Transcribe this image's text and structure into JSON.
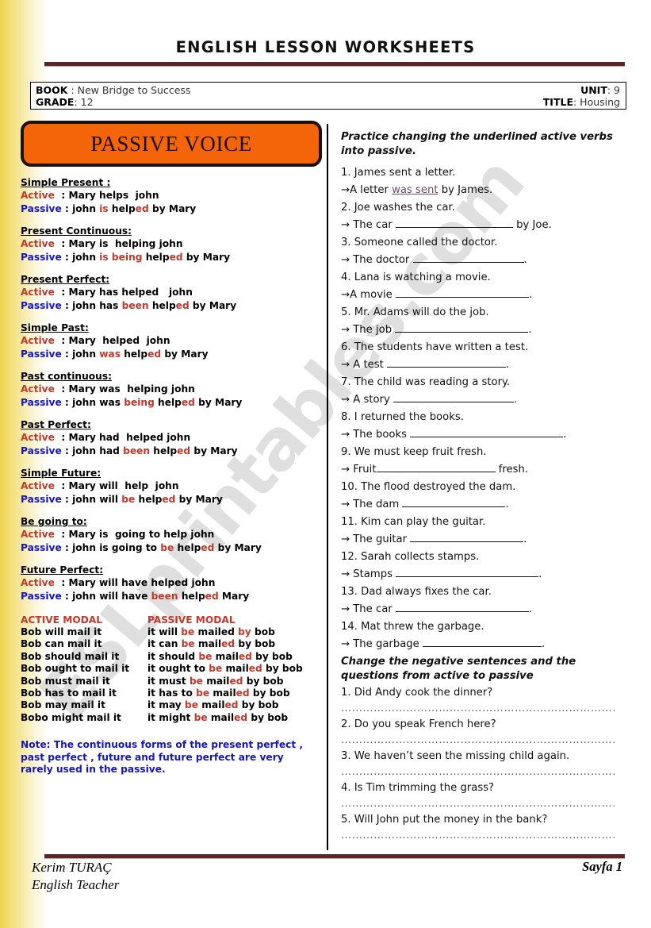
{
  "header": {
    "doc_title": "ENGLISH LESSON WORKSHEETS",
    "book_label": "BOOK",
    "book_value": ": New Bridge to Success",
    "grade_label": "GRADE",
    "grade_value": ": 12",
    "unit_label": "UNIT",
    "unit_value": ": 9",
    "title_label": "TITLE",
    "title_value": ": Housing"
  },
  "left": {
    "title_box": "PASSIVE VOICE",
    "active_label": "Active",
    "passive_label": "Passive",
    "tenses": [
      {
        "head": "Simple Present :",
        "active_sep": "  : ",
        "active": "Mary helps  john",
        "passive_sep": " : ",
        "passive_pre": "john ",
        "passive_aux": "is",
        "passive_mid": " help",
        "passive_ed": "ed",
        "passive_post": " by Mary"
      },
      {
        "head": "Present Continuous:",
        "active_sep": "  : ",
        "active": "Mary is  helping john",
        "passive_sep": " : ",
        "passive_pre": "john ",
        "passive_aux": "is being",
        "passive_mid": " help",
        "passive_ed": "ed",
        "passive_post": " by Mary"
      },
      {
        "head": "Present Perfect:",
        "active_sep": "  : ",
        "active": "Mary has helped   john",
        "passive_sep": " : ",
        "passive_pre": "john has ",
        "passive_aux": "been",
        "passive_mid": " help",
        "passive_ed": "ed",
        "passive_post": " by Mary"
      },
      {
        "head": "Simple Past:",
        "active_sep": "  : ",
        "active": "Mary  helped  john",
        "passive_sep": " : ",
        "passive_pre": "john ",
        "passive_aux": "was",
        "passive_mid": " help",
        "passive_ed": "ed",
        "passive_post": " by Mary"
      },
      {
        "head": "Past continuous:",
        "active_sep": "  : ",
        "active": "Mary was  helping john",
        "passive_sep": " : ",
        "passive_pre": "john was ",
        "passive_aux": "being",
        "passive_mid": " help",
        "passive_ed": "ed",
        "passive_post": " by Mary"
      },
      {
        "head": "Past Perfect:",
        "active_sep": "  : ",
        "active": "Mary had  helped john",
        "passive_sep": " : ",
        "passive_pre": "john had ",
        "passive_aux": "been",
        "passive_mid": " help",
        "passive_ed": "ed",
        "passive_post": " by Mary"
      },
      {
        "head": "Simple Future:",
        "active_sep": "  : ",
        "active": "Mary will  help  john",
        "passive_sep": " : ",
        "passive_pre": "john will ",
        "passive_aux": "be",
        "passive_mid": " help",
        "passive_ed": "ed",
        "passive_post": " by Mary"
      },
      {
        "head": "Be going to:",
        "active_sep": "  : ",
        "active": "Mary is  going to help john",
        "passive_sep": " : ",
        "passive_pre": "john is going to ",
        "passive_aux": "be",
        "passive_mid": " help",
        "passive_ed": "ed",
        "passive_post": " by Mary"
      },
      {
        "head": "Future Perfect:",
        "active_sep": "  : ",
        "active": "Mary will have helped john",
        "passive_sep": " : ",
        "passive_pre": "john will have ",
        "passive_aux": "been",
        "passive_mid": " help",
        "passive_ed": "ed",
        "passive_post": " Mary"
      }
    ],
    "modal": {
      "head_active": "ACTIVE MODAL",
      "head_passive": "PASSIVE MODAL",
      "rows": [
        {
          "active": "Bob will mail it",
          "p1": "it will ",
          "be": "be",
          "p2": " mailed ",
          "by": "by",
          "p3": " bob"
        },
        {
          "active": "Bob can mail it",
          "p1": "it can ",
          "be": "be",
          "p2": " mail",
          "ed": "ed",
          "p3": " by bob"
        },
        {
          "active": "Bob should mail it",
          "p1": "it should ",
          "be": "be",
          "p2": " mail",
          "ed": "ed",
          "p3": " by bob"
        },
        {
          "active": "Bob ought to mail it",
          "p1": "it ought to ",
          "be": "be",
          "p2": " mail",
          "ed": "ed",
          "p3": " by bob"
        },
        {
          "active": "Bob must mail it",
          "p1": "it must ",
          "be": "be",
          "p2": " mail",
          "ed": "ed",
          "p3": " by bob"
        },
        {
          "active": "Bob has to mail it",
          "p1": "it has to ",
          "be": "be",
          "p2": " mail",
          "ed": "ed",
          "p3": " by bob"
        },
        {
          "active": "Bob may mail it",
          "p1": "it may ",
          "be": "be",
          "p2": " mail",
          "ed": "ed",
          "p3": " by bob"
        },
        {
          "active": "Bobo might mail it",
          "p1": "it might ",
          "be": "be",
          "p2": " mail",
          "ed": "ed",
          "p3": " by bob"
        }
      ]
    },
    "note": "Note: The continuous forms of the present perfect , past perfect , future and future perfect are very rarely used in the passive."
  },
  "right": {
    "instruction": "Practice changing the underlined active verbs into passive.",
    "exercises": [
      {
        "num": "1.",
        "sentence": "James sent a letter.",
        "arrow": "→",
        "lead": "A letter ",
        "answer": "was sent",
        "tail": " by James.",
        "blank": 0
      },
      {
        "num": "2.",
        "sentence": "Joe washes the car.",
        "arrow": "→",
        "lead": " The car ",
        "answer": "",
        "tail": " by Joe.",
        "blank": 148
      },
      {
        "num": "3.",
        "sentence": "Someone called the doctor.",
        "arrow": "→",
        "lead": " The doctor ",
        "answer": "",
        "tail": ".",
        "blank": 140
      },
      {
        "num": "4.",
        "sentence": "Lana is watching a movie.",
        "arrow": "→",
        "lead": "A movie ",
        "answer": "",
        "tail": ".",
        "blank": 168
      },
      {
        "num": "5.",
        "sentence": "Mr. Adams will do the job.",
        "arrow": "→",
        "lead": " The job ",
        "answer": "",
        "tail": ".",
        "blank": 168
      },
      {
        "num": "6.",
        "sentence": "The students have written a test.",
        "arrow": "→",
        "lead": " A test ",
        "answer": "",
        "tail": ".",
        "blank": 150
      },
      {
        "num": "7.",
        "sentence": "The child was reading a story.",
        "arrow": "→",
        "lead": " A story ",
        "answer": "",
        "tail": ".",
        "blank": 152
      },
      {
        "num": "8.",
        "sentence": "I returned the books.",
        "arrow": "→",
        "lead": " The books ",
        "answer": "",
        "tail": ".",
        "blank": 193
      },
      {
        "num": "9.",
        "sentence": "We must keep fruit fresh.",
        "arrow": "→",
        "lead": " Fruit",
        "answer": "",
        "tail": " fresh.",
        "blank": 150
      },
      {
        "num": "10.",
        "sentence": "The flood destroyed the dam.",
        "arrow": "→",
        "lead": " The dam ",
        "answer": "",
        "tail": ".",
        "blank": 130
      },
      {
        "num": "11.",
        "sentence": "Kim can play the guitar.",
        "arrow": "→",
        "lead": " The guitar ",
        "answer": "",
        "tail": ".",
        "blank": 143
      },
      {
        "num": "12.",
        "sentence": "Sarah collects stamps.",
        "arrow": "→",
        "lead": " Stamps ",
        "answer": "",
        "tail": ".",
        "blank": 180
      },
      {
        "num": "13.",
        "sentence": "Dad always fixes the car.",
        "arrow": "→",
        "lead": " The car ",
        "answer": "",
        "tail": ".",
        "blank": 168
      },
      {
        "num": "14.",
        "sentence": "Mat threw the garbage.",
        "arrow": "→",
        "lead": " The garbage ",
        "answer": "",
        "tail": ".",
        "blank": 150
      }
    ],
    "instruction2": "Change the negative sentences and the questions from active to passive",
    "questions": [
      "1. Did Andy cook the dinner?",
      "2. Do you speak French here?",
      "3. We haven’t seen the missing child again.",
      "4. Is Tim trimming the grass?",
      "5. Will John put the money in the bank?"
    ],
    "dot_line": "………………………………………………………………………………………………………………………"
  },
  "footer": {
    "author": "Kerim TURAÇ",
    "role": "English Teacher",
    "page": "Sayfa 1"
  },
  "watermark": "ESLprintables.com",
  "colors": {
    "accent_orange": "#F4650A",
    "rule_brown": "#5B2626",
    "active_red": "#C0392B",
    "passive_blue": "#1515C0",
    "strip_yellow": "#EFD24E"
  }
}
